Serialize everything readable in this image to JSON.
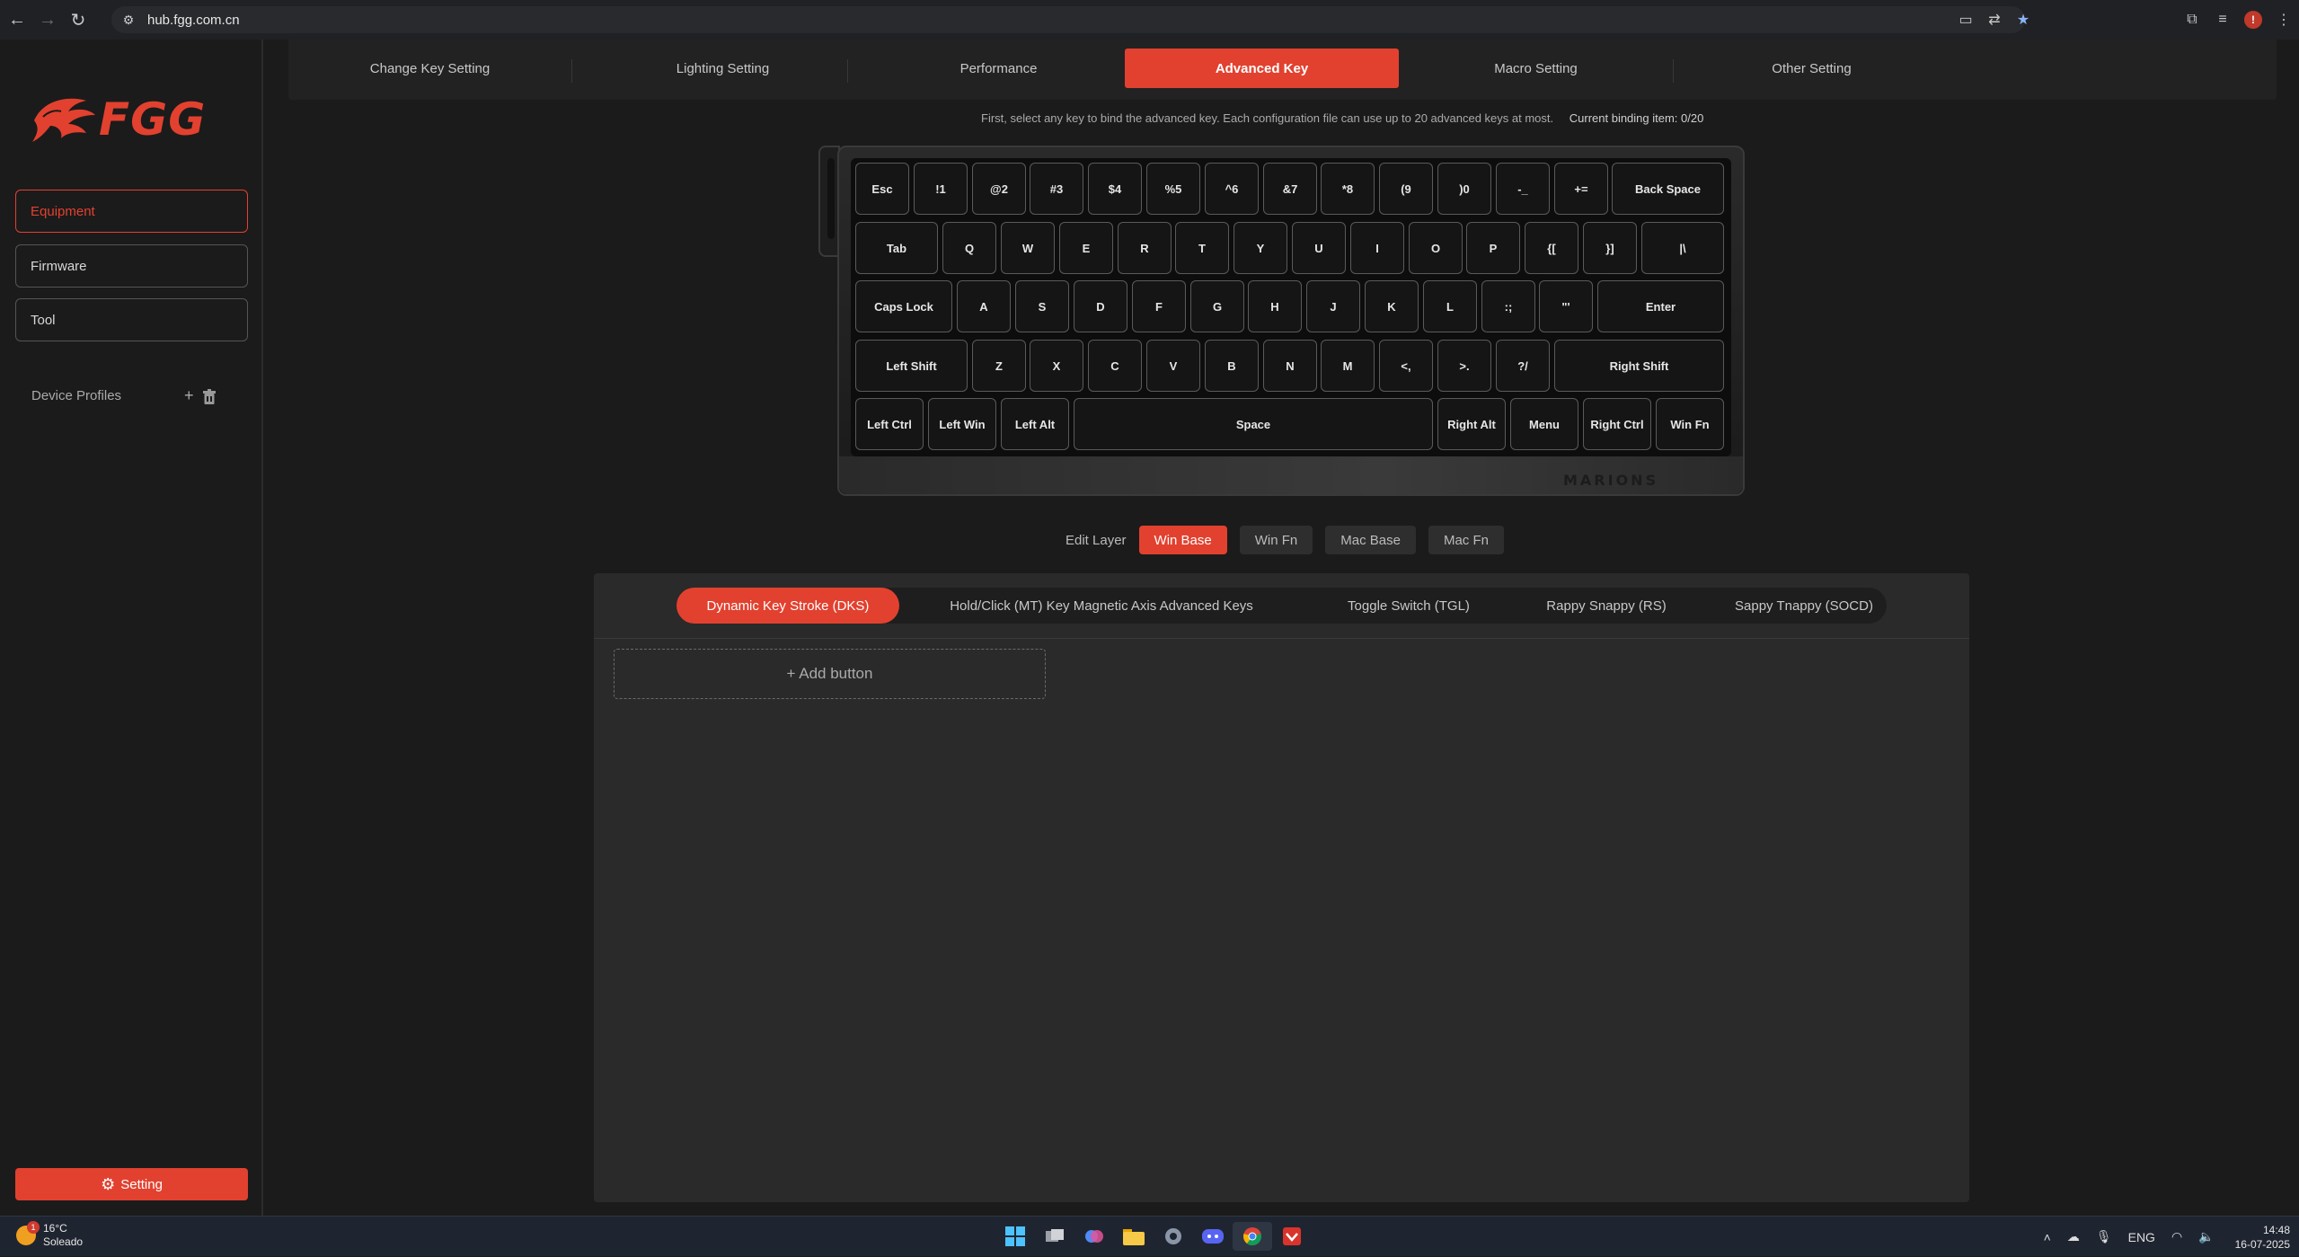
{
  "browser": {
    "url": "hub.fgg.com.cn",
    "nav": {
      "back": "←",
      "forward": "→",
      "reload": "↻"
    },
    "profile_initial": "!"
  },
  "sidebar": {
    "logo_text": "FGG",
    "items": [
      {
        "label": "Equipment",
        "active": true
      },
      {
        "label": "Firmware",
        "active": false
      },
      {
        "label": "Tool",
        "active": false
      }
    ],
    "device_profiles_label": "Device Profiles",
    "add_symbol": "+",
    "setting_label": "Setting"
  },
  "top_tabs": [
    {
      "label": "Change Key Setting",
      "active": false
    },
    {
      "label": "Lighting Setting",
      "active": false
    },
    {
      "label": "Performance",
      "active": false
    },
    {
      "label": "Advanced Key",
      "active": true
    },
    {
      "label": "Macro Setting",
      "active": false
    },
    {
      "label": "Other Setting",
      "active": false
    }
  ],
  "hint": {
    "text": "First, select any key to bind the advanced key. Each configuration file can use up to 20 advanced keys at most.",
    "binding": "Current binding item: 0/20"
  },
  "keyboard": {
    "brand": "MARIONS",
    "rows": [
      [
        {
          "label": "Esc",
          "u": 1
        },
        {
          "label": "!1",
          "u": 1
        },
        {
          "label": "@2",
          "u": 1
        },
        {
          "label": "#3",
          "u": 1
        },
        {
          "label": "$4",
          "u": 1
        },
        {
          "label": "%5",
          "u": 1
        },
        {
          "label": "^6",
          "u": 1
        },
        {
          "label": "&7",
          "u": 1
        },
        {
          "label": "*8",
          "u": 1
        },
        {
          "label": "(9",
          "u": 1
        },
        {
          "label": ")0",
          "u": 1
        },
        {
          "label": "-_",
          "u": 1
        },
        {
          "label": "+=",
          "u": 1
        },
        {
          "label": "Back Space",
          "u": 2
        }
      ],
      [
        {
          "label": "Tab",
          "u": 1.5
        },
        {
          "label": "Q",
          "u": 1
        },
        {
          "label": "W",
          "u": 1
        },
        {
          "label": "E",
          "u": 1
        },
        {
          "label": "R",
          "u": 1
        },
        {
          "label": "T",
          "u": 1
        },
        {
          "label": "Y",
          "u": 1
        },
        {
          "label": "U",
          "u": 1
        },
        {
          "label": "I",
          "u": 1
        },
        {
          "label": "O",
          "u": 1
        },
        {
          "label": "P",
          "u": 1
        },
        {
          "label": "{[",
          "u": 1
        },
        {
          "label": "}]",
          "u": 1
        },
        {
          "label": "|\\",
          "u": 1.5
        }
      ],
      [
        {
          "label": "Caps Lock",
          "u": 1.75
        },
        {
          "label": "A",
          "u": 1
        },
        {
          "label": "S",
          "u": 1
        },
        {
          "label": "D",
          "u": 1
        },
        {
          "label": "F",
          "u": 1
        },
        {
          "label": "G",
          "u": 1
        },
        {
          "label": "H",
          "u": 1
        },
        {
          "label": "J",
          "u": 1
        },
        {
          "label": "K",
          "u": 1
        },
        {
          "label": "L",
          "u": 1
        },
        {
          "label": ":;",
          "u": 1
        },
        {
          "label": "\"'",
          "u": 1
        },
        {
          "label": "Enter",
          "u": 2.25
        }
      ],
      [
        {
          "label": "Left Shift",
          "u": 2
        },
        {
          "label": "Z",
          "u": 1
        },
        {
          "label": "X",
          "u": 1
        },
        {
          "label": "C",
          "u": 1
        },
        {
          "label": "V",
          "u": 1
        },
        {
          "label": "B",
          "u": 1
        },
        {
          "label": "N",
          "u": 1
        },
        {
          "label": "M",
          "u": 1
        },
        {
          "label": "<,",
          "u": 1
        },
        {
          "label": ">.",
          "u": 1
        },
        {
          "label": "?/",
          "u": 1
        },
        {
          "label": "Right Shift",
          "u": 3
        }
      ],
      [
        {
          "label": "Left Ctrl",
          "u": 1.25
        },
        {
          "label": "Left Win",
          "u": 1.25
        },
        {
          "label": "Left Alt",
          "u": 1.25
        },
        {
          "label": "Space",
          "u": 6.25
        },
        {
          "label": "Right Alt",
          "u": 1.25
        },
        {
          "label": "Menu",
          "u": 1.25
        },
        {
          "label": "Right Ctrl",
          "u": 1.25
        },
        {
          "label": "Win Fn",
          "u": 1.25
        }
      ]
    ]
  },
  "layers": {
    "label": "Edit Layer",
    "options": [
      {
        "label": "Win Base",
        "active": true
      },
      {
        "label": "Win Fn",
        "active": false
      },
      {
        "label": "Mac Base",
        "active": false
      },
      {
        "label": "Mac Fn",
        "active": false
      }
    ]
  },
  "advanced": {
    "tabs": [
      {
        "label": "Dynamic Key Stroke (DKS)",
        "active": true
      },
      {
        "label": "Hold/Click (MT) Key Magnetic Axis Advanced Keys",
        "active": false
      },
      {
        "label": "Toggle Switch (TGL)",
        "active": false
      },
      {
        "label": "Rappy Snappy  (RS)",
        "active": false
      },
      {
        "label": "Sappy Tnappy  (SOCD)",
        "active": false
      }
    ],
    "add_button": "+ Add button"
  },
  "taskbar": {
    "weather": {
      "temp": "16°C",
      "condition": "Soleado",
      "badge": "1"
    },
    "lang": "ENG",
    "time": "14:48",
    "date": "16-07-2025"
  }
}
